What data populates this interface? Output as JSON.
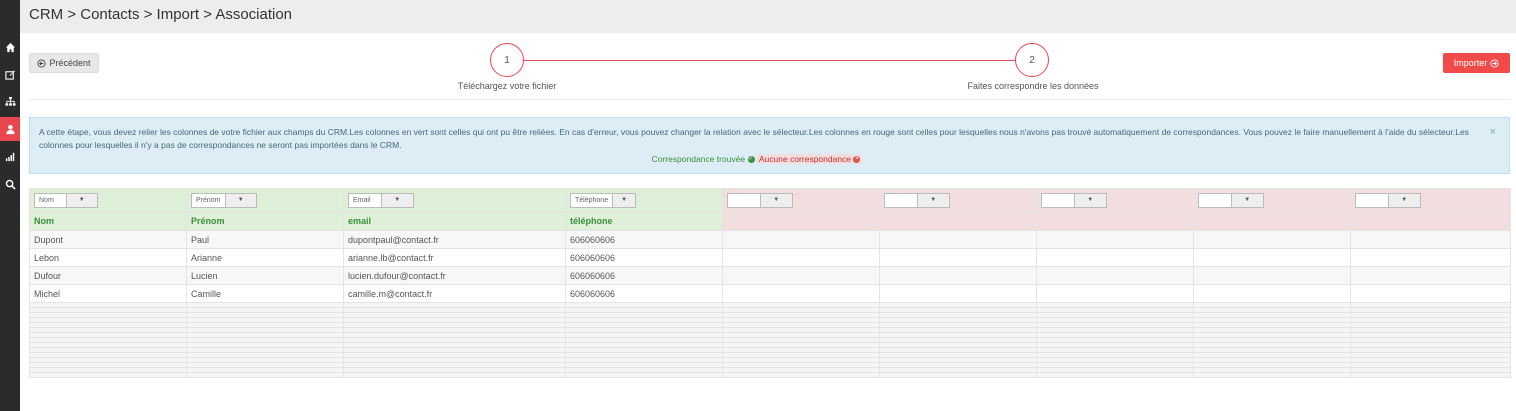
{
  "breadcrumb": "CRM > Contacts > Import > Association",
  "sidebar": {
    "items": [
      {
        "icon": "home-icon"
      },
      {
        "icon": "edit-icon"
      },
      {
        "icon": "sitemap-icon"
      },
      {
        "icon": "user-icon"
      },
      {
        "icon": "signal-icon"
      },
      {
        "icon": "search-icon"
      }
    ]
  },
  "buttons": {
    "previous": "Précédent",
    "import": "Importer"
  },
  "steps": [
    {
      "number": "1",
      "label": "Téléchargez votre fichier"
    },
    {
      "number": "2",
      "label": "Faites correspondre les données"
    }
  ],
  "alert": {
    "text": "A cette étape, vous devez relier les colonnes de votre fichier aux champs du CRM.Les colonnes en vert sont celles qui ont pu être reliées. En cas d'erreur, vous pouvez changer la relation avec le sélecteur.Les colonnes en rouge sont celles pour lesquelles nous n'avons pas trouvé automatiquement de correspondances. Vous pouvez le faire manuellement à l'aide du sélecteur.Les colonnes pour lesquelles il n'y a pas de correspondances ne seront pas importées dans le CRM.",
    "found": "Correspondance trouvée",
    "not_found": "Aucune correspondance",
    "close": "×"
  },
  "table": {
    "selectors": [
      "Nom",
      "Prénom",
      "Email",
      "Téléphone",
      "",
      "",
      "",
      "",
      ""
    ],
    "headers": [
      "Nom",
      "Prénom",
      "email",
      "téléphone",
      "",
      "",
      "",
      "",
      ""
    ],
    "rows": [
      [
        "Dupont",
        "Paul",
        "dupontpaul@contact.fr",
        "606060606",
        "",
        "",
        "",
        "",
        ""
      ],
      [
        "Lebon",
        "Arianne",
        "arianne.lb@contact.fr",
        "606060606",
        "",
        "",
        "",
        "",
        ""
      ],
      [
        "Dufour",
        "Lucien",
        "lucien.dufour@contact.fr",
        "606060606",
        "",
        "",
        "",
        "",
        ""
      ],
      [
        "Michel",
        "Camille",
        "camille.m@contact.fr",
        "606060606",
        "",
        "",
        "",
        "",
        ""
      ]
    ],
    "matched_columns": 4
  },
  "colors": {
    "accent": "#e8474e",
    "import": "#f04b4b",
    "matched": "#dff0d8",
    "unmatched": "#f2dede"
  }
}
